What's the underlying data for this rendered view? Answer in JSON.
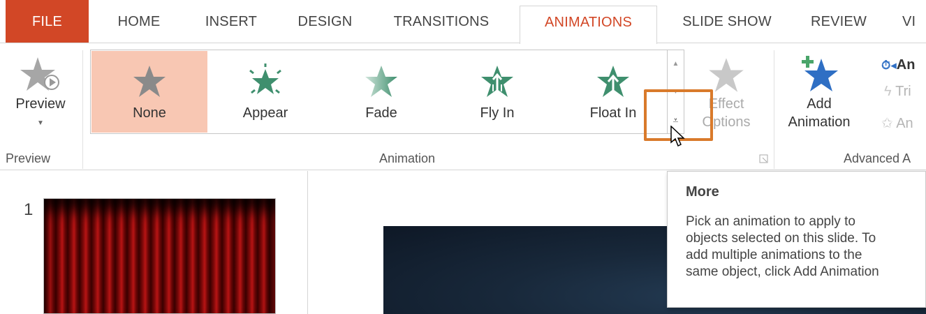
{
  "tabs": [
    {
      "label": "FILE"
    },
    {
      "label": "HOME"
    },
    {
      "label": "INSERT"
    },
    {
      "label": "DESIGN"
    },
    {
      "label": "TRANSITIONS"
    },
    {
      "label": "ANIMATIONS"
    },
    {
      "label": "SLIDE SHOW"
    },
    {
      "label": "REVIEW"
    },
    {
      "label": "VI"
    }
  ],
  "active_tab": "ANIMATIONS",
  "preview_group": {
    "button_label": "Preview",
    "group_label": "Preview"
  },
  "animation_group": {
    "group_label": "Animation",
    "gallery": [
      {
        "label": "None",
        "icon": "star-none-icon",
        "selected": true
      },
      {
        "label": "Appear",
        "icon": "star-appear-icon"
      },
      {
        "label": "Fade",
        "icon": "star-fade-icon"
      },
      {
        "label": "Fly In",
        "icon": "star-fly-in-icon"
      },
      {
        "label": "Float In",
        "icon": "star-float-in-icon"
      }
    ],
    "effect_options_line1": "Effect",
    "effect_options_line2": "Options"
  },
  "advanced_group": {
    "group_label": "Advanced A",
    "add_animation_line1": "Add",
    "add_animation_line2": "Animation",
    "animation_pane_label": "An",
    "trigger_label": "Tri",
    "animation_painter_label": "An"
  },
  "slide_panel": {
    "slide_number": "1"
  },
  "tooltip": {
    "title": "More",
    "lines": [
      "Pick an animation to apply to",
      "objects selected on this slide.  To",
      "add multiple animations to the",
      "same object, click Add Animation"
    ]
  },
  "colors": {
    "accent": "#d24726",
    "selection": "#f8c7b3",
    "highlight_box": "#d97a2b",
    "animation_green": "#3f8f6e"
  }
}
